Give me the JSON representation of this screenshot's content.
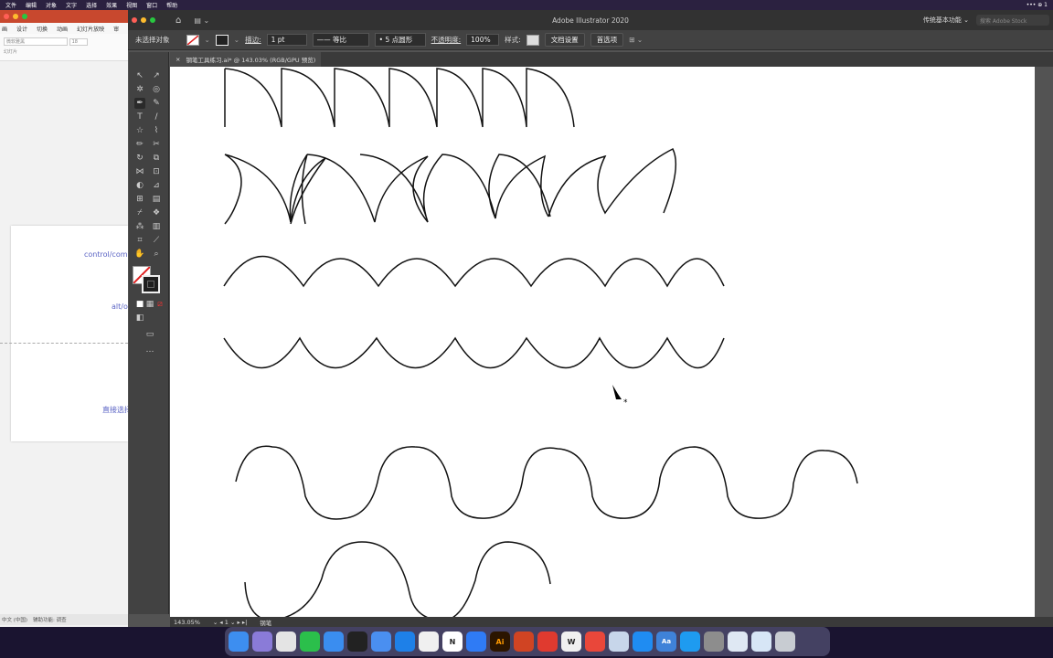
{
  "menubar": {
    "items": [
      "文件",
      "编辑",
      "对象",
      "文字",
      "选择",
      "效果",
      "视图",
      "窗口",
      "帮助"
    ],
    "right": "••• ⊕ 1"
  },
  "ppt": {
    "tabs": [
      "画",
      "设计",
      "切换",
      "动画",
      "幻灯片放映",
      "审"
    ],
    "font_name": "微软雅黑",
    "font_size": "18",
    "slide_label": "幻灯片",
    "slide_text": [
      "control/comm",
      "alt/o",
      "直接选择"
    ],
    "status": [
      "中文 (中国)",
      "辅助功能: 调查"
    ]
  },
  "illustrator": {
    "title": "Adobe Illustrator 2020",
    "workspace": "传统基本功能",
    "stock_placeholder": "搜索 Adobe Stock",
    "control": {
      "selection": "未选择对象",
      "stroke_label": "描边:",
      "stroke_value": "1 pt",
      "stroke_profile": "等比",
      "brush": "5 点圆形",
      "opacity_label": "不透明度:",
      "opacity_value": "100%",
      "style_label": "样式:",
      "doc_setup": "文档设置",
      "prefs": "首选项"
    },
    "doc_tab": "钢笔工具练习.ai* @ 143.03% (RGB/GPU 预览)",
    "status": {
      "zoom": "143.05%",
      "artboard": "1",
      "tool": "钢笔"
    }
  },
  "dock": {
    "apps": [
      {
        "name": "finder",
        "color": "#3d8ef0",
        "glyph": ""
      },
      {
        "name": "launchpad",
        "color": "#8a7bd8",
        "glyph": ""
      },
      {
        "name": "chrome",
        "color": "#e4e4e4",
        "glyph": ""
      },
      {
        "name": "wechat",
        "color": "#2bbf4b",
        "glyph": ""
      },
      {
        "name": "qq-browser",
        "color": "#3a8df0",
        "glyph": ""
      },
      {
        "name": "qq",
        "color": "#222222",
        "glyph": ""
      },
      {
        "name": "mail",
        "color": "#4a8ff0",
        "glyph": ""
      },
      {
        "name": "safari",
        "color": "#1e80e8",
        "glyph": ""
      },
      {
        "name": "tasks",
        "color": "#f0f0f0",
        "glyph": ""
      },
      {
        "name": "notion",
        "color": "#ffffff",
        "glyph": "N"
      },
      {
        "name": "feishu",
        "color": "#2f7bf5",
        "glyph": ""
      },
      {
        "name": "illustrator",
        "color": "#2b1500",
        "glyph": "Ai"
      },
      {
        "name": "powerpoint",
        "color": "#d04423",
        "glyph": ""
      },
      {
        "name": "video",
        "color": "#e03a2f",
        "glyph": ""
      },
      {
        "name": "wps",
        "color": "#f0f0f0",
        "glyph": "W"
      },
      {
        "name": "notes",
        "color": "#e9473a",
        "glyph": ""
      },
      {
        "name": "preview",
        "color": "#c7d6ea",
        "glyph": ""
      },
      {
        "name": "appstore",
        "color": "#1f8cf2",
        "glyph": ""
      },
      {
        "name": "dictionary",
        "color": "#3f82d8",
        "glyph": "Aa"
      },
      {
        "name": "qq2",
        "color": "#1e9bf0",
        "glyph": ""
      },
      {
        "name": "settings",
        "color": "#8d8d8d",
        "glyph": ""
      },
      {
        "name": "finder-window",
        "color": "#dfe8f3",
        "glyph": ""
      },
      {
        "name": "downloads",
        "color": "#d7e6f6",
        "glyph": ""
      },
      {
        "name": "trash",
        "color": "#c8ccd2",
        "glyph": ""
      }
    ]
  }
}
